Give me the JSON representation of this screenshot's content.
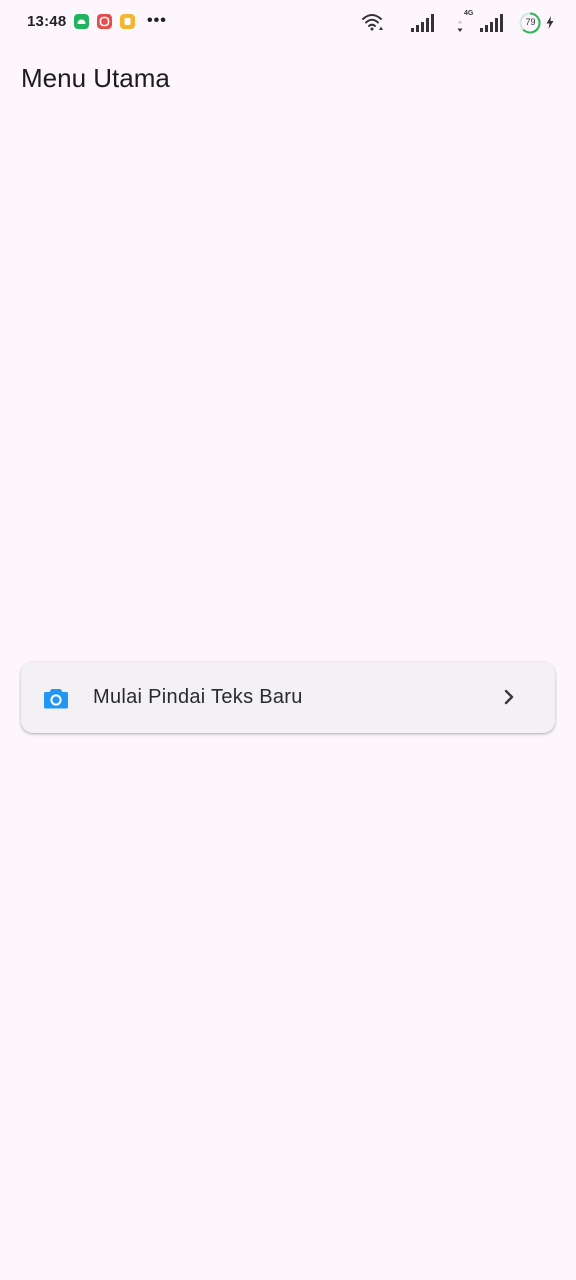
{
  "status_bar": {
    "time": "13:48",
    "more": "•••",
    "network_label": "4G",
    "battery_level": "79",
    "notification_colors": [
      "#22b35e",
      "#e84c4c",
      "#f5b731"
    ]
  },
  "app_bar": {
    "title": "Menu Utama"
  },
  "menu": {
    "items": [
      {
        "label": "Mulai Pindai Teks Baru",
        "icon": "camera-icon",
        "icon_color": "#2196f3",
        "trailing_icon": "chevron-right-icon"
      }
    ]
  },
  "colors": {
    "background": "#fdf7fd",
    "card": "#f4f1f5",
    "text": "#1d1b20",
    "accent": "#2196f3",
    "battery_ring": "#2fb55a"
  }
}
